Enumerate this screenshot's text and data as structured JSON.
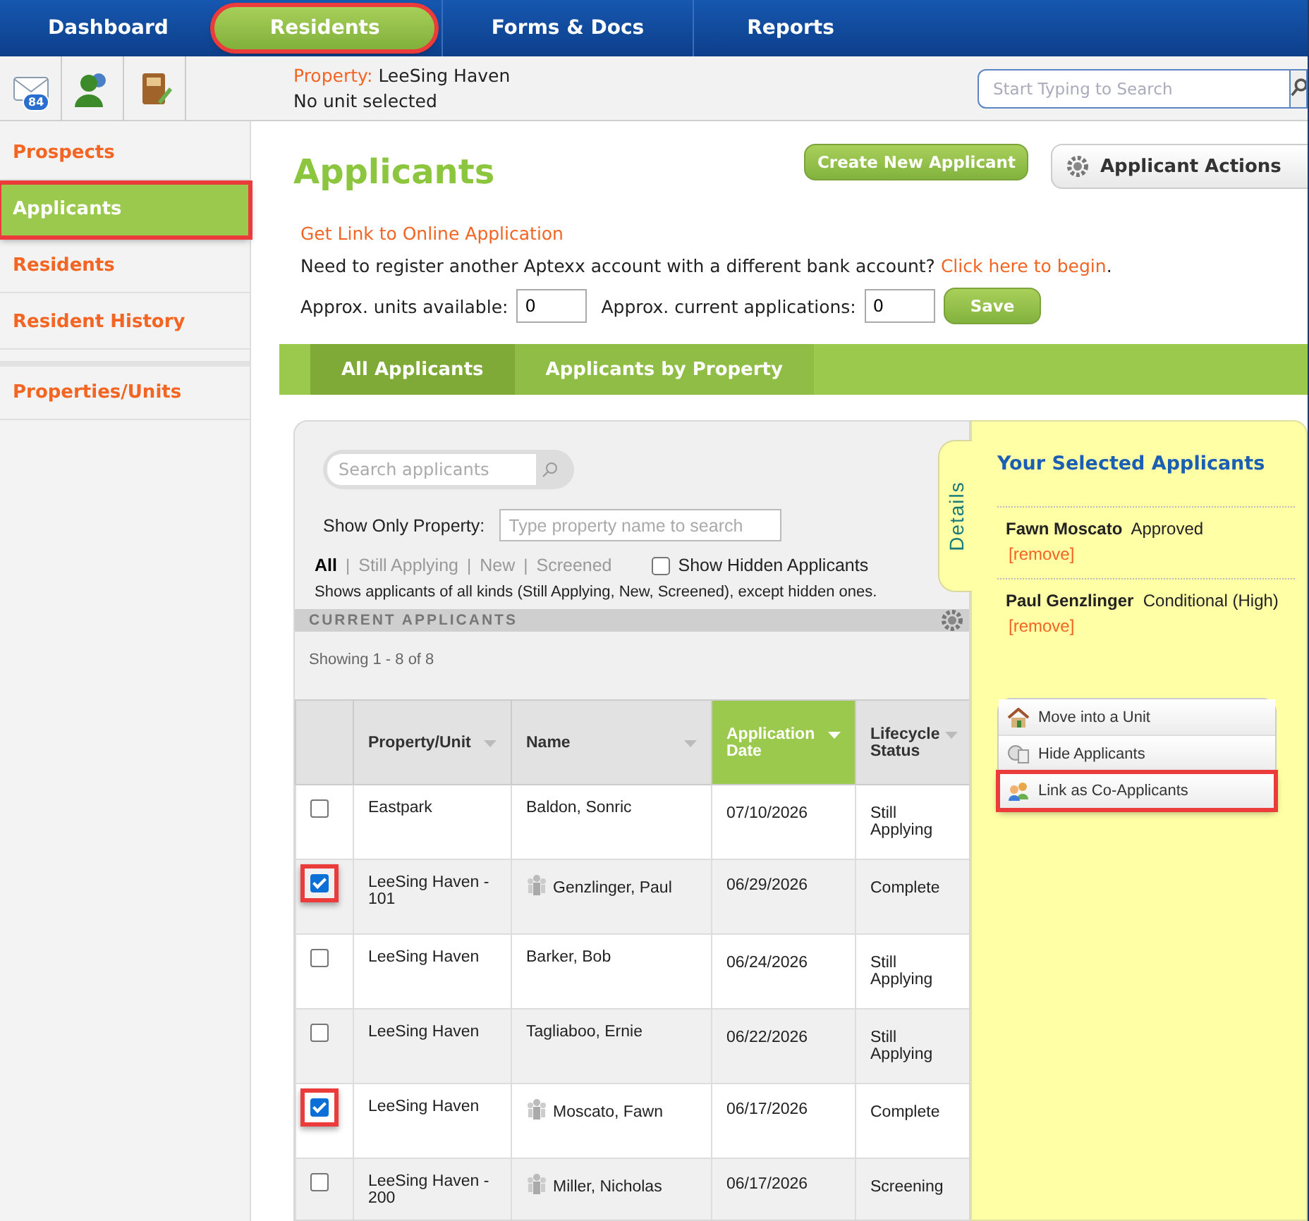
{
  "nav": {
    "tabs": [
      {
        "label": "Dashboard",
        "selected": false,
        "highlighted": false
      },
      {
        "label": "Residents",
        "selected": true,
        "highlighted": true
      },
      {
        "label": "Forms & Docs",
        "selected": false,
        "highlighted": false
      },
      {
        "label": "Reports",
        "selected": false,
        "highlighted": false
      }
    ]
  },
  "toolbar": {
    "mail_badge": "84",
    "property_label": "Property:",
    "property_value": "LeeSing Haven",
    "unit": "No unit selected",
    "search": {
      "placeholder": "Start Typing to Search"
    }
  },
  "sidebar": {
    "items": [
      {
        "label": "Prospects",
        "selected": false,
        "highlighted": false
      },
      {
        "label": "Applicants",
        "selected": true,
        "highlighted": true
      },
      {
        "label": "Residents",
        "selected": false,
        "highlighted": false
      },
      {
        "label": "Resident History",
        "selected": false,
        "highlighted": false
      },
      {
        "label": "Properties/Units",
        "selected": false,
        "highlighted": false
      }
    ]
  },
  "page": {
    "title": "Applicants",
    "create_button": "Create New Applicant",
    "actions_button": "Applicant Actions",
    "online_link": "Get Link to Online Application",
    "register_text": "Need to register another Aptexx account with a different bank account?",
    "register_link": "Click here to begin",
    "register_end": ".",
    "units_label": "Approx. units available:",
    "units_value": "0",
    "apps_label": "Approx. current applications:",
    "apps_value": "0",
    "save_button": "Save"
  },
  "tabs": [
    {
      "label": "All Applicants",
      "selected": true
    },
    {
      "label": "Applicants by Property",
      "selected": false
    }
  ],
  "filters": {
    "search": {
      "placeholder": "Search applicants"
    },
    "property_label": "Show Only Property:",
    "property": {
      "placeholder": "Type property name to search"
    },
    "statuses": [
      {
        "label": "All",
        "selected": true
      },
      {
        "label": "Still Applying",
        "selected": false
      },
      {
        "label": "New",
        "selected": false
      },
      {
        "label": "Screened",
        "selected": false
      }
    ],
    "separator": "|",
    "show_hidden": {
      "label": "Show Hidden Applicants",
      "checked": false
    },
    "note": "Shows applicants of all kinds (Still Applying, New, Screened), except hidden ones."
  },
  "table": {
    "section_title": "CURRENT APPLICANTS",
    "showing": "Showing 1 - 8 of 8",
    "columns": [
      {
        "label": "Property/Unit",
        "sorted": false
      },
      {
        "label": "Name",
        "sorted": false
      },
      {
        "label": "Application Date",
        "sorted": true
      },
      {
        "label": "Lifecycle Status",
        "sorted": false
      }
    ],
    "rows": [
      {
        "checked": false,
        "highlighted": false,
        "property": "Eastpark",
        "household": false,
        "name": "Baldon, Sonric",
        "date": "07/10/2026",
        "status": "Still Applying"
      },
      {
        "checked": true,
        "highlighted": true,
        "property": "LeeSing Haven - 101",
        "household": true,
        "name": "Genzlinger, Paul",
        "date": "06/29/2026",
        "status": "Complete"
      },
      {
        "checked": false,
        "highlighted": false,
        "property": "LeeSing Haven",
        "household": false,
        "name": "Barker, Bob",
        "date": "06/24/2026",
        "status": "Still Applying"
      },
      {
        "checked": false,
        "highlighted": false,
        "property": "LeeSing Haven",
        "household": false,
        "name": "Tagliaboo, Ernie",
        "date": "06/22/2026",
        "status": "Still Applying"
      },
      {
        "checked": true,
        "highlighted": true,
        "property": "LeeSing Haven",
        "household": true,
        "name": "Moscato, Fawn",
        "date": "06/17/2026",
        "status": "Complete"
      },
      {
        "checked": false,
        "highlighted": false,
        "property": "LeeSing Haven - 200",
        "household": true,
        "name": "Miller, Nicholas",
        "date": "06/17/2026",
        "status": "Screening"
      }
    ]
  },
  "details": {
    "tab": "Details",
    "title": "Your Selected Applicants",
    "selected": [
      {
        "name": "Fawn Moscato",
        "status": "Approved",
        "remove": "[remove]"
      },
      {
        "name": "Paul Genzlinger",
        "status": "Conditional (High)",
        "remove": "[remove]"
      }
    ],
    "actions": [
      {
        "kind": "house",
        "label": "Move into a Unit",
        "highlighted": false
      },
      {
        "kind": "hide",
        "label": "Hide Applicants",
        "highlighted": false
      },
      {
        "kind": "people",
        "label": "Link as Co-Applicants",
        "highlighted": true
      }
    ]
  }
}
